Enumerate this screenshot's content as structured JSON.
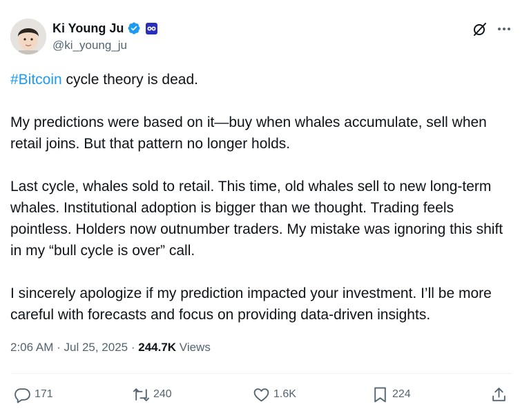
{
  "author": {
    "display_name": "Ki Young Ju",
    "handle": "@ki_young_ju",
    "verified": true,
    "verified_color": "#1d9bf0",
    "affiliation_color": "#2a2fb8"
  },
  "post": {
    "hashtag": "#Bitcoin",
    "line1_rest": " cycle theory is dead.",
    "p2": "My predictions were based on it—buy when whales accumulate, sell when retail joins. But that pattern no longer holds.",
    "p3": "Last cycle, whales sold to retail. This time, old whales sell to new long-term whales. Institutional adoption is bigger than we thought. Trading feels pointless. Holders now outnumber traders. My mistake was ignoring this shift in my “bull cycle is over” call.",
    "p4": "I sincerely apologize if my prediction impacted your investment. I’ll be more careful with forecasts and focus on providing data-driven insights."
  },
  "meta": {
    "time": "2:06 AM",
    "sep1": " · ",
    "date": "Jul 25, 2025",
    "sep2": " · ",
    "views_count": "244.7K",
    "views_label": " Views"
  },
  "actions": {
    "replies": "171",
    "reposts": "240",
    "likes": "1.6K",
    "bookmarks": "224"
  },
  "colors": {
    "text": "#0f1419",
    "secondary": "#536471",
    "link": "#1d9bf0"
  }
}
